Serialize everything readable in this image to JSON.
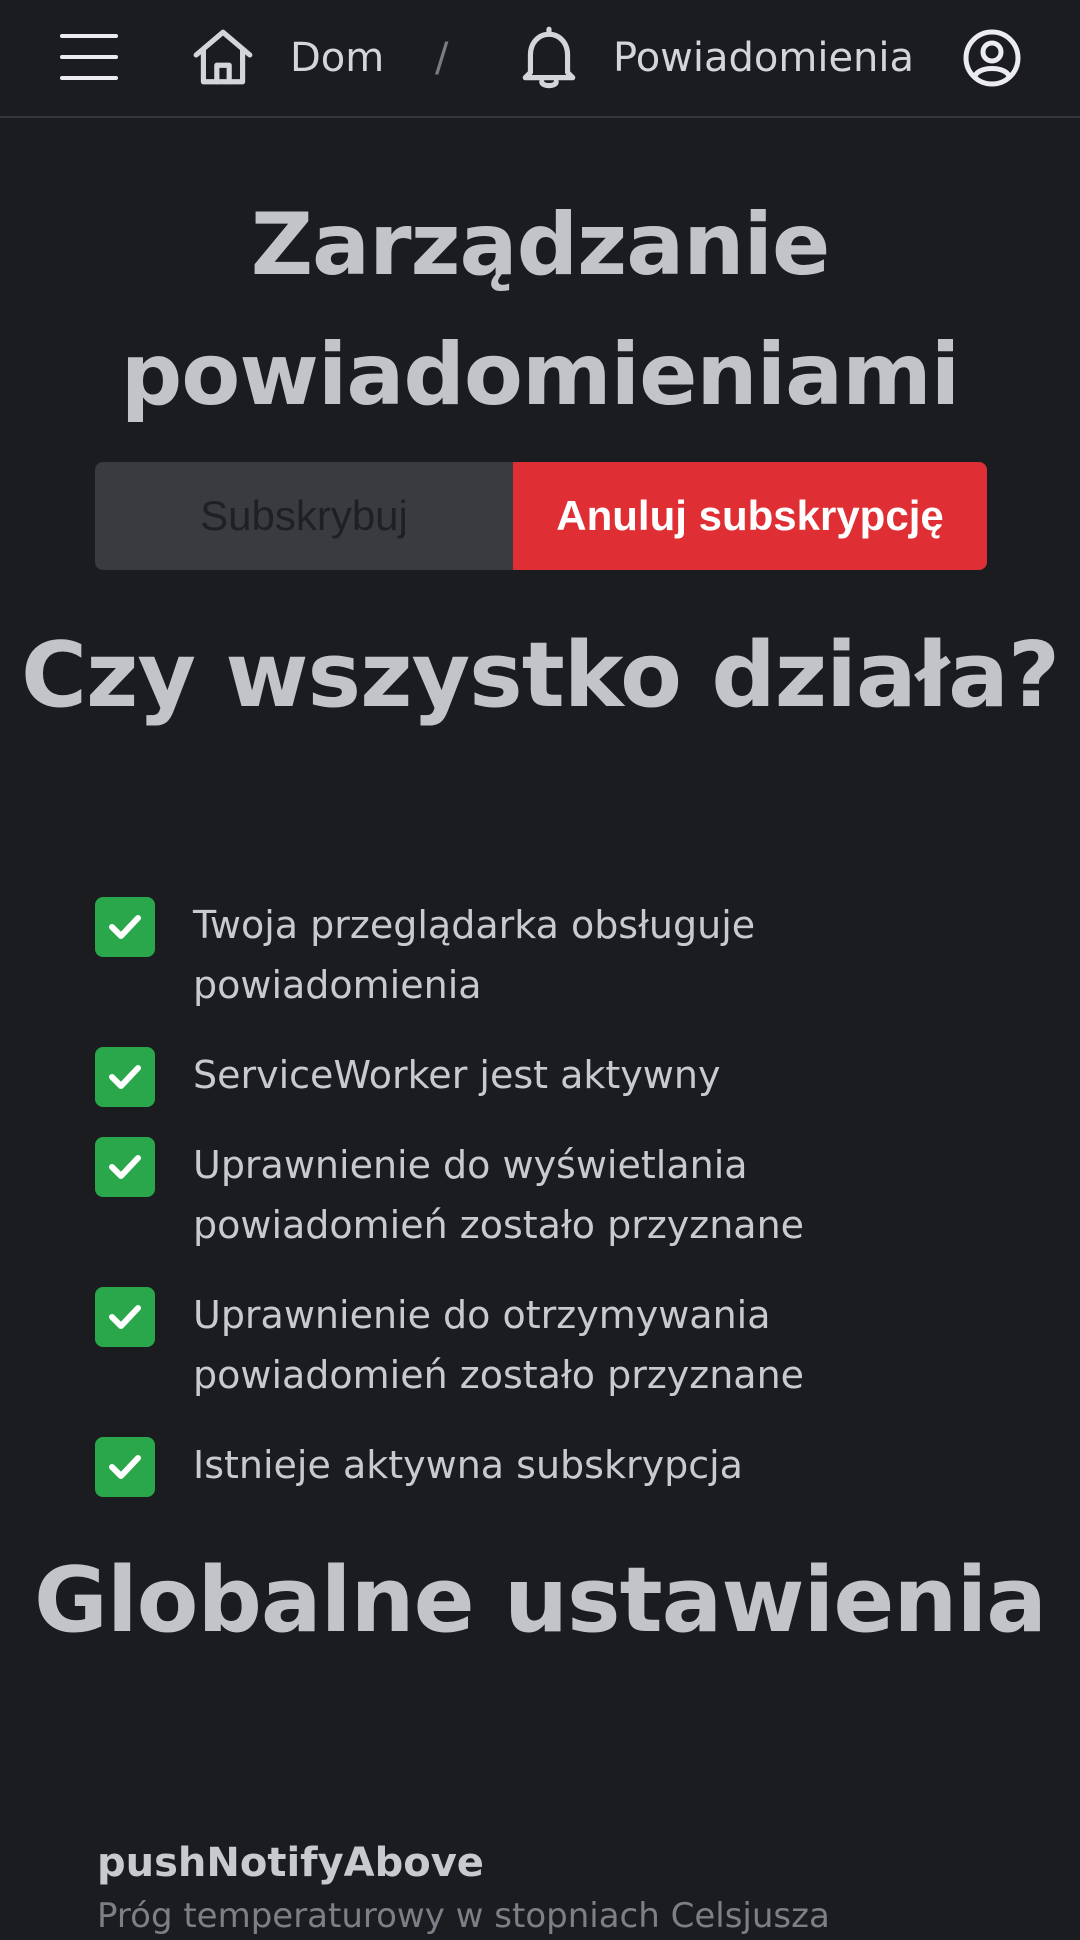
{
  "topbar": {
    "menu_icon": "hamburger-menu-icon",
    "home_icon": "home-icon",
    "home_label": "Dom",
    "separator": "/",
    "bell_icon": "bell-icon",
    "current_label": "Powiadomienia",
    "user_icon": "user-circle-icon"
  },
  "page_title": "Zarządzanie powiadomieniami",
  "subscription": {
    "subscribe_label": "Subskrybuj",
    "unsubscribe_label": "Anuluj subskrypcję",
    "active_button": "unsubscribe",
    "unsubscribe_color": "#df2f34"
  },
  "status_section": {
    "title": "Czy wszystko działa?",
    "check_icon": "checkmark-icon",
    "check_color": "#2aa74a",
    "items": [
      {
        "label": "Twoja przeglądarka obsługuje powiadomienia",
        "checked": true
      },
      {
        "label": "ServiceWorker jest aktywny",
        "checked": true
      },
      {
        "label": "Uprawnienie do wyświetlania powiadomień zostało przyznane",
        "checked": true
      },
      {
        "label": "Uprawnienie do otrzymywania powiadomień zostało przyznane",
        "checked": true
      },
      {
        "label": "Istnieje aktywna subskrypcja",
        "checked": true
      }
    ]
  },
  "global_section": {
    "title": "Globalne ustawienia",
    "setting_name": "pushNotifyAbove",
    "setting_description": "Próg temperaturowy w stopniach Celsjusza"
  }
}
